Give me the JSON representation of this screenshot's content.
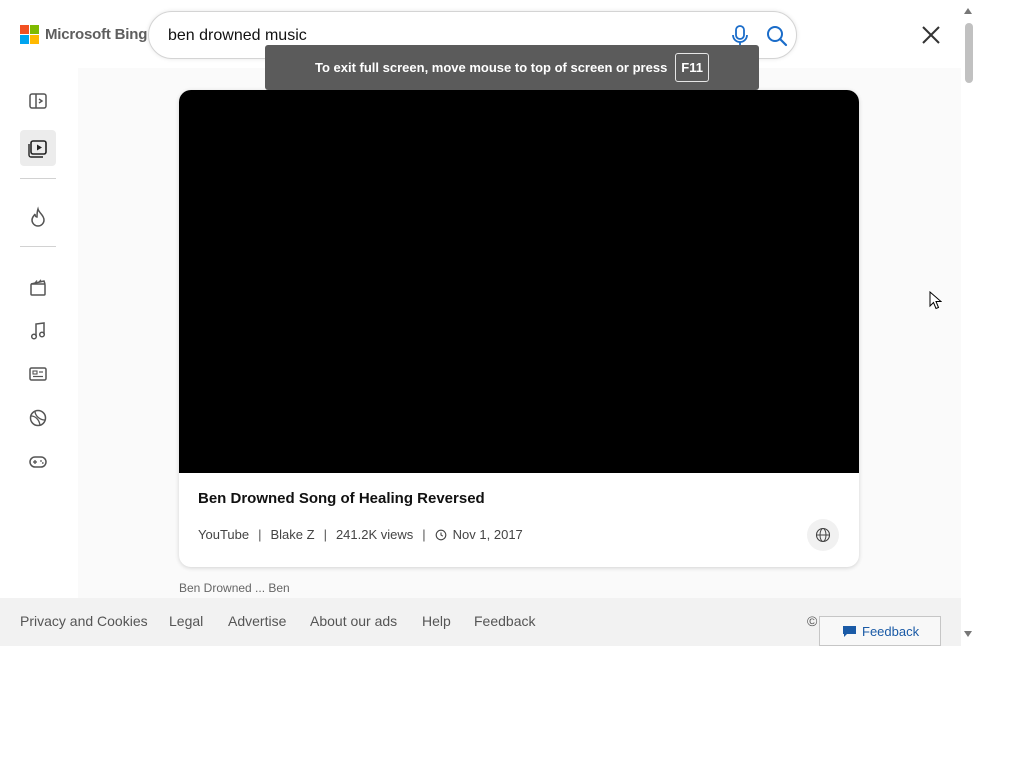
{
  "header": {
    "logo_text": "Microsoft Bing",
    "search": {
      "value": "ben drowned music",
      "placeholder": ""
    },
    "icons": {
      "mic": "microphone-icon",
      "search": "search-icon",
      "close": "close-icon"
    }
  },
  "fullscreen_toast": {
    "message": "To exit full screen, move mouse to top of screen or press",
    "key": "F11"
  },
  "sidebar": {
    "icons": [
      "panel-toggle-icon",
      "video-play-icon",
      "trending-flame-icon",
      "movie-clapper-icon",
      "music-note-icon",
      "news-icon",
      "sports-ball-icon",
      "gaming-controller-icon"
    ],
    "active": "video-play-icon"
  },
  "video_card": {
    "title": "Ben Drowned Song of Healing Reversed",
    "source": "YouTube",
    "channel": "Blake Z",
    "views": "241.2K views",
    "date": "Nov 1, 2017",
    "separator": "|"
  },
  "peek_text": "Ben Drowned ... Ben",
  "footer": {
    "links": [
      "Privacy and Cookies",
      "Legal",
      "Advertise",
      "About our ads",
      "Help",
      "Feedback"
    ],
    "copyright": "©",
    "feedback_button": "Feedback"
  },
  "colors": {
    "ms_red": "#f25022",
    "ms_green": "#7fba00",
    "ms_blue": "#00a4ef",
    "ms_yellow": "#ffb900",
    "link_blue": "#1a5aa6",
    "toast_bg": "#5b5b5b"
  }
}
